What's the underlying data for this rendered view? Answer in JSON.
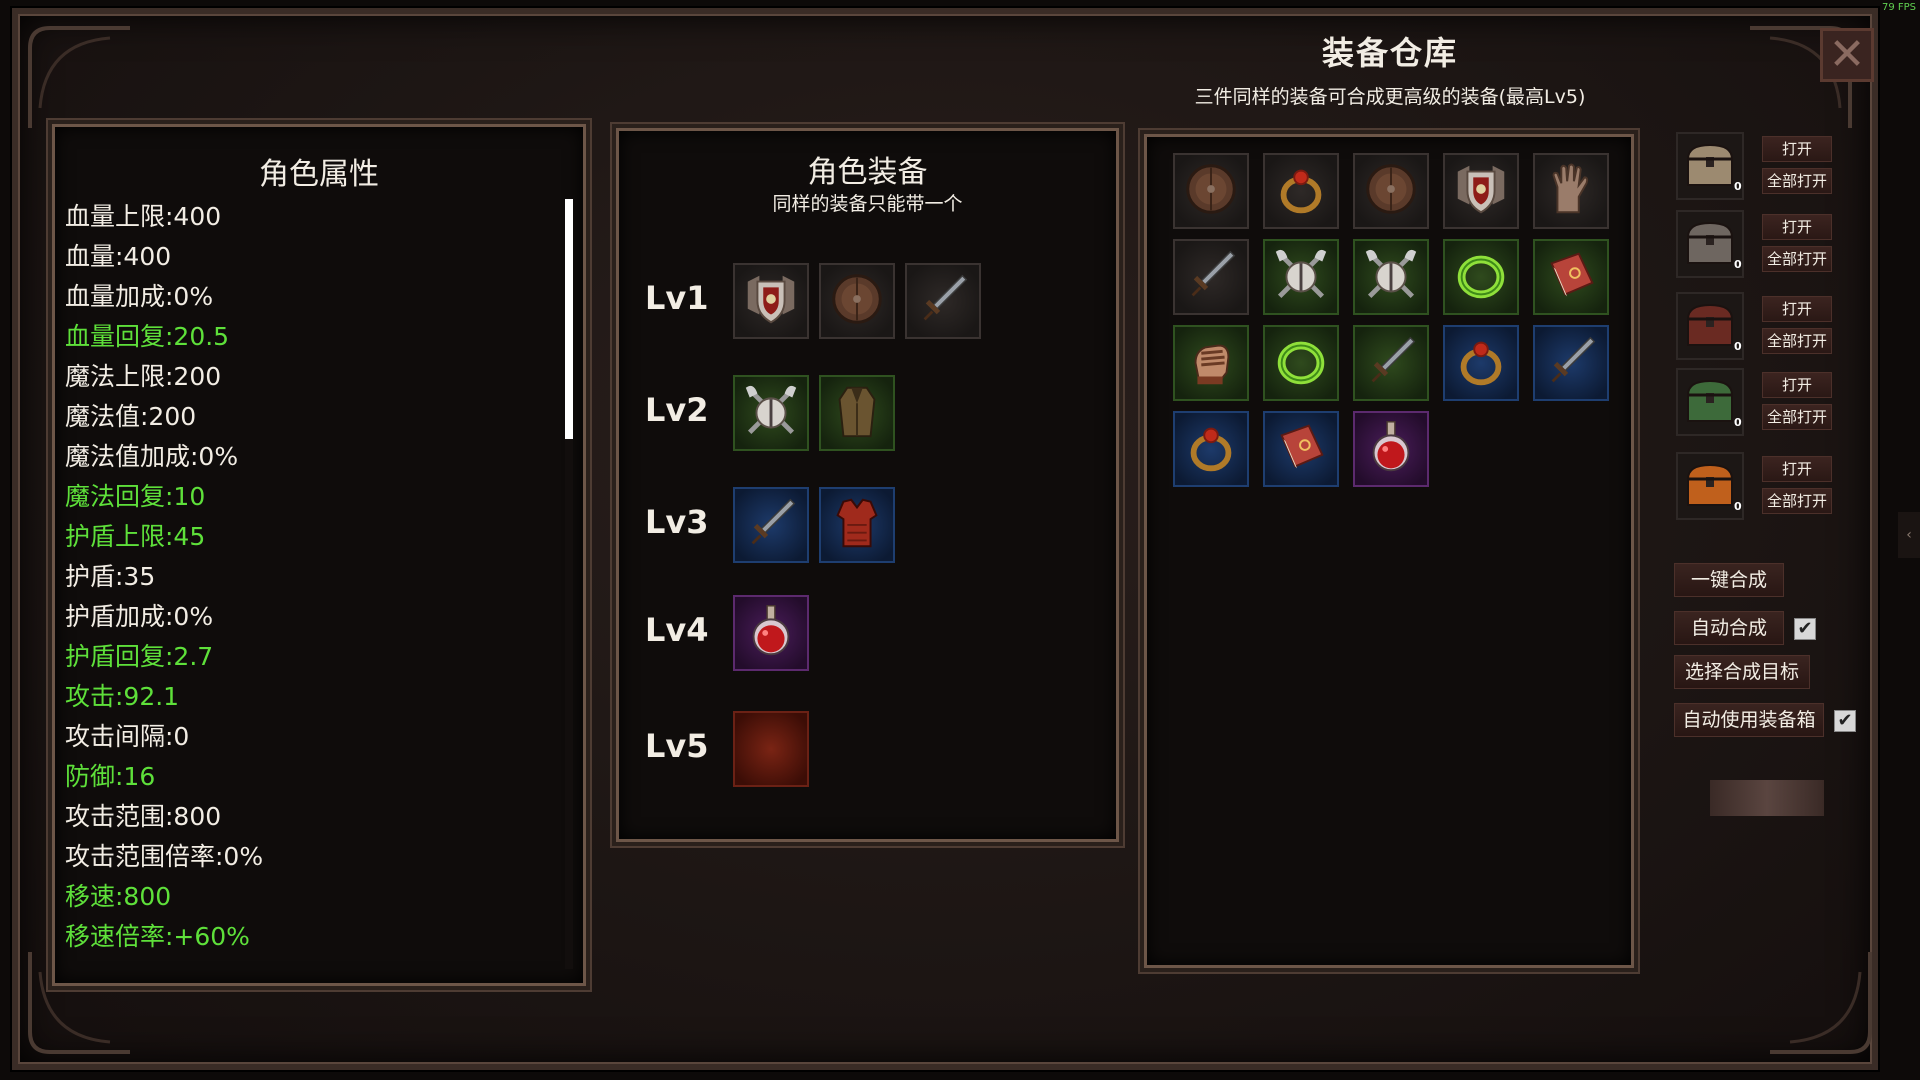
{
  "fps": "79 FPS",
  "warehouse": {
    "title": "装备仓库",
    "subtitle": "三件同样的装备可合成更高级的装备(最高Lv5)"
  },
  "attributes": {
    "title": "角色属性",
    "rows": [
      {
        "text": "血量上限:400",
        "color": "white"
      },
      {
        "text": "血量:400",
        "color": "white"
      },
      {
        "text": "血量加成:0%",
        "color": "white"
      },
      {
        "text": "血量回复:20.5",
        "color": "green"
      },
      {
        "text": "魔法上限:200",
        "color": "white"
      },
      {
        "text": "魔法值:200",
        "color": "white"
      },
      {
        "text": "魔法值加成:0%",
        "color": "white"
      },
      {
        "text": "魔法回复:10",
        "color": "green"
      },
      {
        "text": "护盾上限:45",
        "color": "green"
      },
      {
        "text": "护盾:35",
        "color": "white"
      },
      {
        "text": "护盾加成:0%",
        "color": "white"
      },
      {
        "text": "护盾回复:2.7",
        "color": "green"
      },
      {
        "text": "攻击:92.1",
        "color": "green"
      },
      {
        "text": "攻击间隔:0",
        "color": "white"
      },
      {
        "text": "防御:16",
        "color": "green"
      },
      {
        "text": "攻击范围:800",
        "color": "white"
      },
      {
        "text": "攻击范围倍率:0%",
        "color": "white"
      },
      {
        "text": "移速:800",
        "color": "green"
      },
      {
        "text": "移速倍率:+60%",
        "color": "green"
      }
    ]
  },
  "equipment": {
    "title": "角色装备",
    "subtitle": "同样的装备只能带一个",
    "levels": [
      {
        "label": "Lv1",
        "items": [
          "shield-crest-icon",
          "round-shield-icon",
          "dagger-icon"
        ],
        "rarity": "r1"
      },
      {
        "label": "Lv2",
        "items": [
          "crossed-axes-shield-icon",
          "robe-icon"
        ],
        "rarity": "r2"
      },
      {
        "label": "Lv3",
        "items": [
          "dagger-icon",
          "armor-vest-icon"
        ],
        "rarity": "r3"
      },
      {
        "label": "Lv4",
        "items": [
          "potion-icon"
        ],
        "rarity": "r4"
      },
      {
        "label": "Lv5",
        "items": [
          "empty-slot"
        ],
        "rarity": "r5"
      }
    ]
  },
  "inventory": [
    {
      "icon": "round-shield-icon",
      "rarity": "r1"
    },
    {
      "icon": "ring-icon",
      "rarity": "r1"
    },
    {
      "icon": "round-shield-icon",
      "rarity": "r1"
    },
    {
      "icon": "shield-crest-icon",
      "rarity": "r1"
    },
    {
      "icon": "glove-icon",
      "rarity": "r1"
    },
    {
      "icon": "dagger-icon",
      "rarity": "r1"
    },
    {
      "icon": "crossed-axes-shield-icon",
      "rarity": "r2"
    },
    {
      "icon": "crossed-axes-shield-icon",
      "rarity": "r2"
    },
    {
      "icon": "green-ring-icon",
      "rarity": "r2"
    },
    {
      "icon": "book-icon",
      "rarity": "r2"
    },
    {
      "icon": "gauntlet-icon",
      "rarity": "r2"
    },
    {
      "icon": "green-ring-icon",
      "rarity": "r2"
    },
    {
      "icon": "dagger-icon",
      "rarity": "r2"
    },
    {
      "icon": "ring-icon",
      "rarity": "r3"
    },
    {
      "icon": "dagger-icon",
      "rarity": "r3"
    },
    {
      "icon": "ring-icon",
      "rarity": "r3"
    },
    {
      "icon": "book-icon",
      "rarity": "r3"
    },
    {
      "icon": "potion-icon",
      "rarity": "r4"
    }
  ],
  "chests": [
    {
      "count": "0",
      "open": "打开",
      "open_all": "全部打开",
      "color": "#9c8a70"
    },
    {
      "count": "0",
      "open": "打开",
      "open_all": "全部打开",
      "color": "#6e6660"
    },
    {
      "count": "0",
      "open": "打开",
      "open_all": "全部打开",
      "color": "#6a2a22"
    },
    {
      "count": "0",
      "open": "打开",
      "open_all": "全部打开",
      "color": "#3d6a3a"
    },
    {
      "count": "0",
      "open": "打开",
      "open_all": "全部打开",
      "color": "#c0601c"
    }
  ],
  "actions": {
    "one_click": "一键合成",
    "auto_merge": "自动合成",
    "auto_merge_checked": true,
    "select_target": "选择合成目标",
    "auto_use_box": "自动使用装备箱",
    "auto_use_box_checked": true
  },
  "colors": {
    "green_text": "#5ee03a",
    "white_text": "#f2ede4"
  }
}
